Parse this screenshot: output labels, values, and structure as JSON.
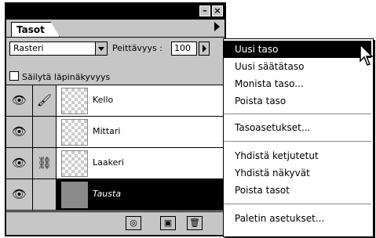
{
  "panel": {
    "tab_label": "Tasot",
    "blend_mode": "Rasteri",
    "opacity_label": "Peittävyys :",
    "opacity_value": "100",
    "preserve_transparency_label": "Säilytä läpinäkyvyys"
  },
  "layers": [
    {
      "name": "Kello",
      "link_icon": "brush-icon",
      "visible": true,
      "active": false
    },
    {
      "name": "Mittari",
      "link_icon": "",
      "visible": true,
      "active": false
    },
    {
      "name": "Laakeri",
      "link_icon": "chain-link-icon",
      "visible": true,
      "active": false
    },
    {
      "name": "Tausta",
      "link_icon": "",
      "visible": true,
      "active": true
    }
  ],
  "menu": {
    "items": [
      "Uusi taso",
      "Uusi säätätaso",
      "Monista taso...",
      "Poista taso",
      "Tasoasetukset...",
      "Yhdistä ketjutetut",
      "Yhdistä näkyvät",
      "Poista tasot",
      "Paletin asetukset..."
    ]
  }
}
